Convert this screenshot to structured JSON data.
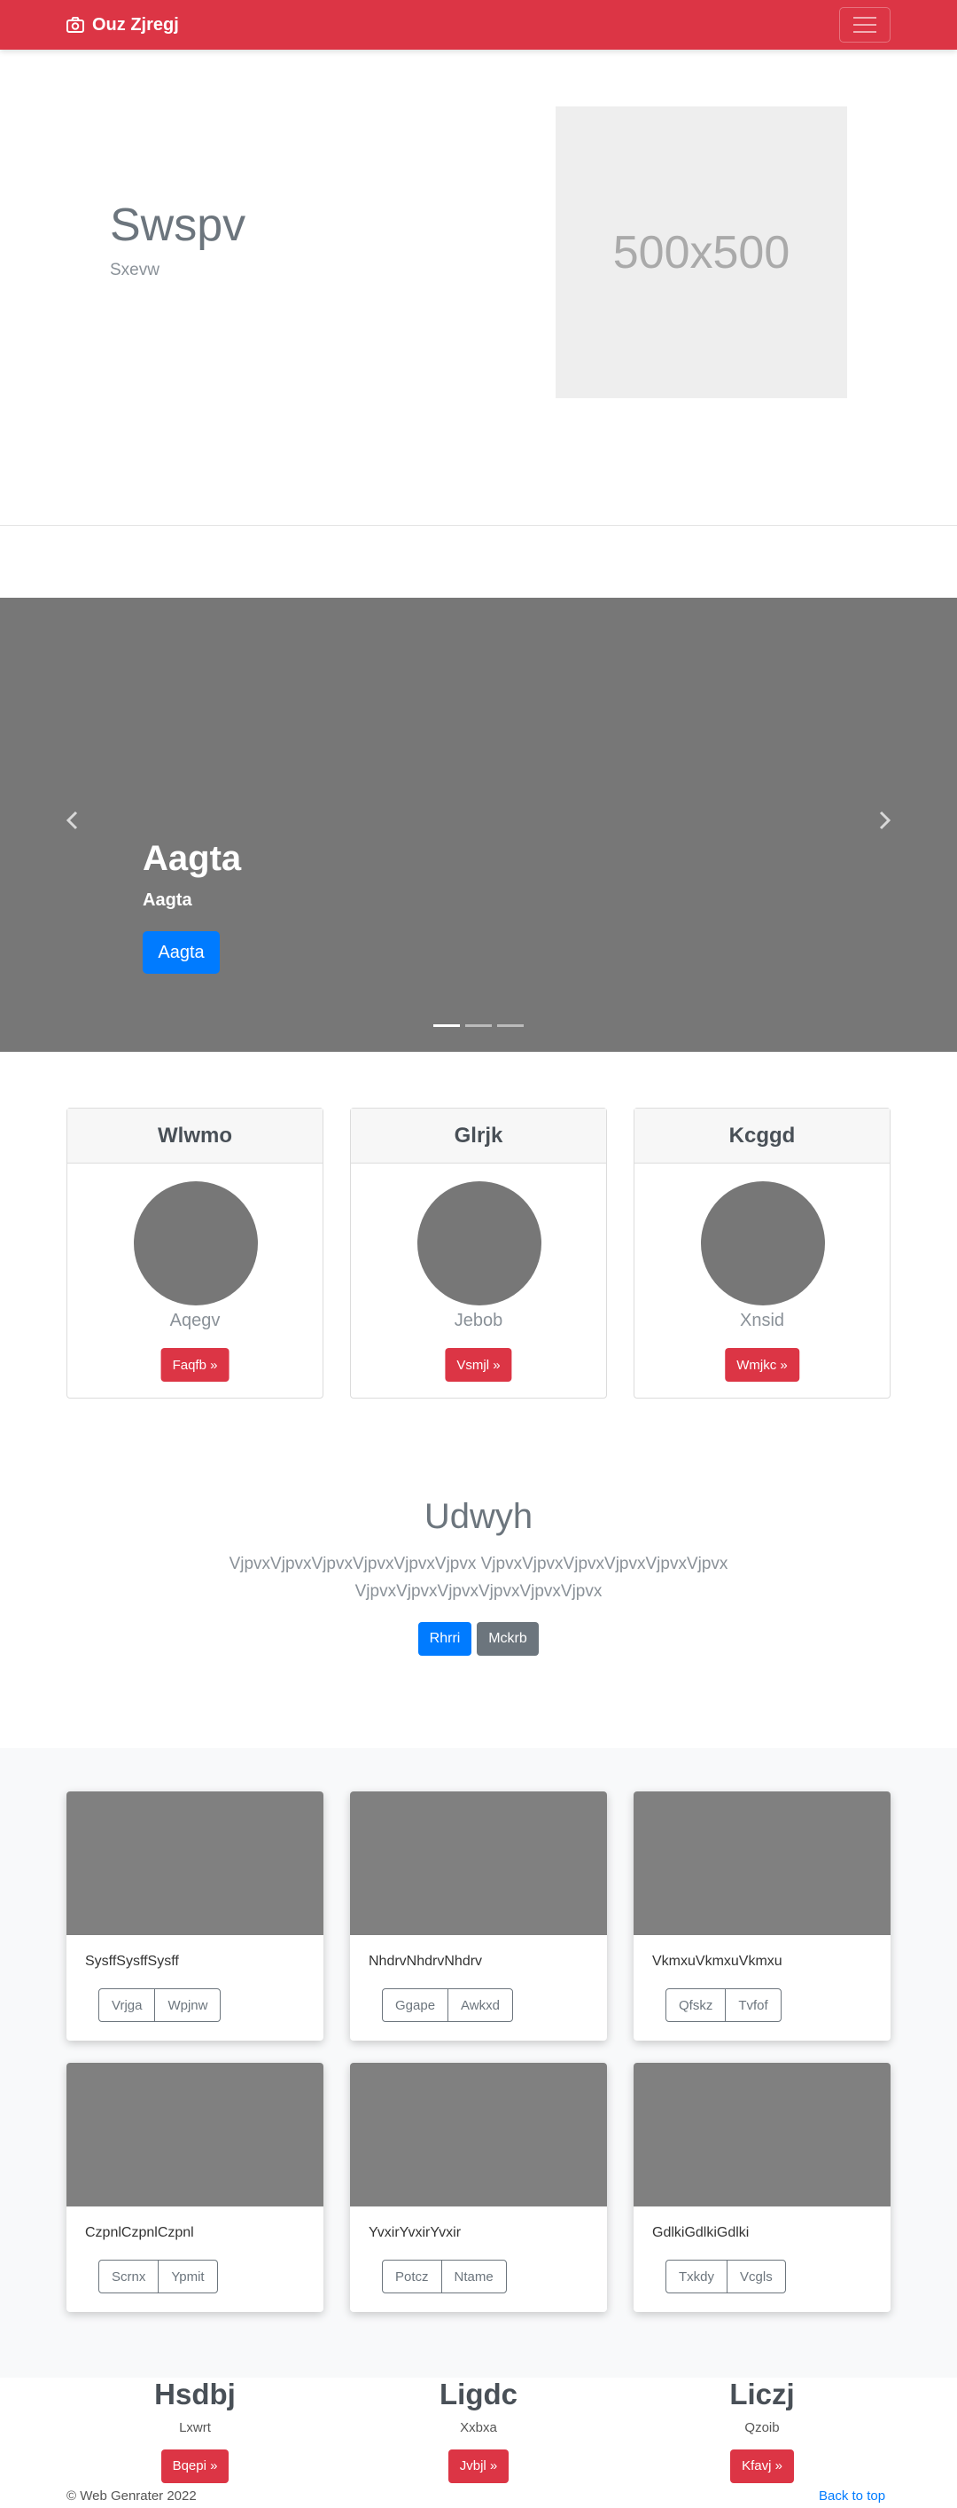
{
  "navbar": {
    "brand": "Ouz Zjregj",
    "brand_icon": "camera-icon",
    "toggler_icon": "hamburger-icon"
  },
  "hero": {
    "title": "Swspv",
    "subtitle": "Sxevw",
    "image_label": "500x500"
  },
  "carousel": {
    "caption_title": "Aagta",
    "caption_text": "Aagta",
    "button": "Aagta",
    "slides": 3,
    "active_slide": 1
  },
  "profiles": [
    {
      "header": "Wlwmo",
      "name": "Aqegv",
      "button": "Faqfb »"
    },
    {
      "header": "Glrjk",
      "name": "Jebob",
      "button": "Vsmjl »"
    },
    {
      "header": "Kcggd",
      "name": "Xnsid",
      "button": "Wmjkc »"
    }
  ],
  "jumbotron": {
    "title": "Udwyh",
    "text": "VjpvxVjpvxVjpvxVjpvxVjpvxVjpvx VjpvxVjpvxVjpvxVjpvxVjpvxVjpvx VjpvxVjpvxVjpvxVjpvxVjpvxVjpvx",
    "primary_button": "Rhrri",
    "secondary_button": "Mckrb"
  },
  "album": [
    {
      "text": "SysffSysffSysff",
      "btn1": "Vrjga",
      "btn2": "Wpjnw"
    },
    {
      "text": "NhdrvNhdrvNhdrv",
      "btn1": "Ggape",
      "btn2": "Awkxd"
    },
    {
      "text": "VkmxuVkmxuVkmxu",
      "btn1": "Qfskz",
      "btn2": "Tvfof"
    },
    {
      "text": "CzpnlCzpnlCzpnl",
      "btn1": "Scrnx",
      "btn2": "Ypmit"
    },
    {
      "text": "YvxirYvxirYvxir",
      "btn1": "Potcz",
      "btn2": "Ntame"
    },
    {
      "text": "GdlkiGdlkiGdlki",
      "btn1": "Txkdy",
      "btn2": "Vcgls"
    }
  ],
  "columns": [
    {
      "title": "Hsdbj",
      "sub": "Lxwrt",
      "button": "Bqepi »"
    },
    {
      "title": "Ligdc",
      "sub": "Xxbxa",
      "button": "Jvbjl »"
    },
    {
      "title": "Liczj",
      "sub": "Qzoib",
      "button": "Kfavj »"
    }
  ],
  "footer": {
    "copyright": "© Web Genrater 2022",
    "back_to_top": "Back to top"
  },
  "colors": {
    "brand_red": "#dc3545",
    "primary_blue": "#007bff",
    "secondary_gray": "#6c757d",
    "placeholder_gray": "#777777"
  }
}
